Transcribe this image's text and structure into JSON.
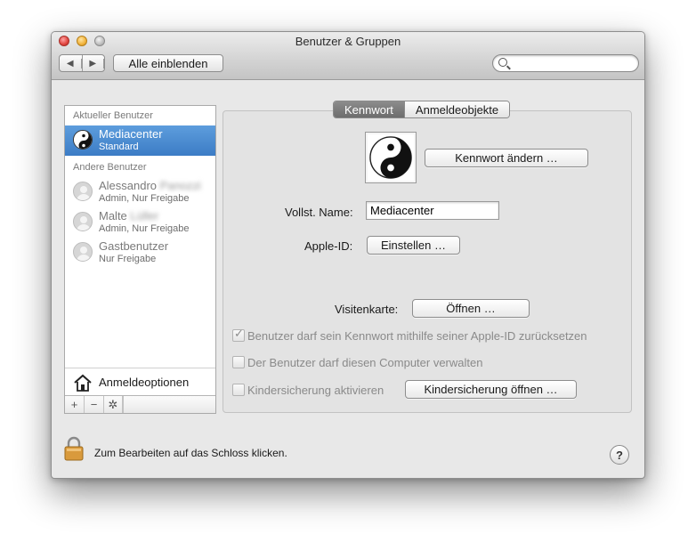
{
  "window": {
    "title": "Benutzer & Gruppen"
  },
  "toolbar": {
    "back_icon": "triangle-left-icon",
    "forward_icon": "triangle-right-icon",
    "show_all_label": "Alle einblenden",
    "search_placeholder": ""
  },
  "sidebar": {
    "current_header": "Aktueller Benutzer",
    "current_user": {
      "name": "Mediacenter",
      "role": "Standard",
      "avatar": "yin-yang-icon"
    },
    "other_header": "Andere Benutzer",
    "other_users": [
      {
        "name": "Alessandro",
        "name_blurred": "Panozzi",
        "role": "Admin, Nur Freigabe"
      },
      {
        "name": "Malte",
        "name_blurred": "Lüller",
        "role": "Admin, Nur Freigabe"
      },
      {
        "name": "Gastbenutzer",
        "name_blurred": "",
        "role": "Nur Freigabe"
      }
    ],
    "login_options_label": "Anmeldeoptionen",
    "add_label": "+",
    "remove_label": "−",
    "action_icon": "gear-icon"
  },
  "tabs": {
    "password": "Kennwort",
    "login_items": "Anmeldeobjekte",
    "active": "Kennwort"
  },
  "panel": {
    "change_password_button": "Kennwort ändern …",
    "fullname_label": "Vollst. Name:",
    "fullname_value": "Mediacenter",
    "appleid_label": "Apple-ID:",
    "appleid_button": "Einstellen …",
    "contact_label": "Visitenkarte:",
    "contact_button": "Öffnen …",
    "reset_checkbox_label": "Benutzer darf sein Kennwort mithilfe seiner Apple-ID zurücksetzen",
    "reset_checked": true,
    "admin_checkbox_label": "Der Benutzer darf diesen Computer verwalten",
    "admin_checked": false,
    "parental_checkbox_label": "Kindersicherung aktivieren",
    "parental_checked": false,
    "parental_button": "Kindersicherung öffnen …"
  },
  "footer": {
    "lock_text": "Zum Bearbeiten auf das Schloss klicken.",
    "help_label": "?"
  }
}
